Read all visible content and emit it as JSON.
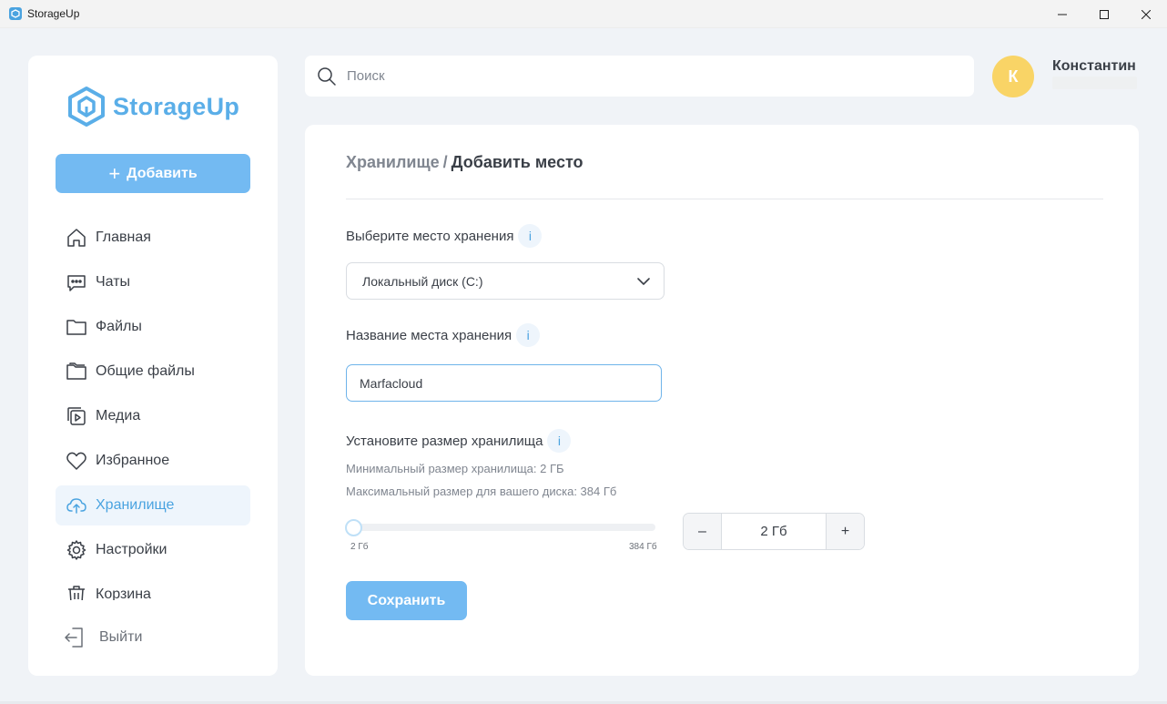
{
  "window": {
    "title": "StorageUp"
  },
  "sidebar": {
    "logo_text": "StorageUp",
    "add_label": "Добавить",
    "items": [
      {
        "label": "Главная",
        "icon": "home-icon",
        "active": false
      },
      {
        "label": "Чаты",
        "icon": "chat-icon",
        "active": false
      },
      {
        "label": "Файлы",
        "icon": "folder-icon",
        "active": false
      },
      {
        "label": "Общие файлы",
        "icon": "shared-folder-icon",
        "active": false
      },
      {
        "label": "Медиа",
        "icon": "media-icon",
        "active": false
      },
      {
        "label": "Избранное",
        "icon": "heart-icon",
        "active": false
      },
      {
        "label": "Хранилище",
        "icon": "cloud-upload-icon",
        "active": true
      },
      {
        "label": "Настройки",
        "icon": "gear-icon",
        "active": false
      },
      {
        "label": "Корзина",
        "icon": "trash-icon",
        "active": false
      }
    ],
    "logout_label": "Выйти"
  },
  "search": {
    "placeholder": "Поиск",
    "value": ""
  },
  "user": {
    "initial": "К",
    "name": "Константин"
  },
  "breadcrumb": {
    "parent": "Хранилище",
    "separator": "/",
    "current": "Добавить место"
  },
  "form": {
    "location_label": "Выберите место хранения",
    "location_value": "Локальный диск (C:)",
    "name_label": "Название места хранения",
    "name_value": "Marfacloud",
    "size_label": "Установите размер хранилища",
    "info_glyph": "i",
    "min_hint": "Минимальный размер хранилища: 2 ГБ",
    "max_hint": "Максимальный размер для вашего диска: 384 Гб",
    "slider": {
      "min_label": "2 Гб",
      "max_label": "384 Гб",
      "min": 2,
      "max": 384,
      "value": 2
    },
    "stepper": {
      "minus": "–",
      "plus": "+",
      "value": "2 Гб"
    },
    "save_label": "Сохранить"
  },
  "colors": {
    "accent": "#73baf2",
    "accent_text": "#4aa3e0",
    "avatar": "#f9d466",
    "background": "#f0f3f7"
  }
}
